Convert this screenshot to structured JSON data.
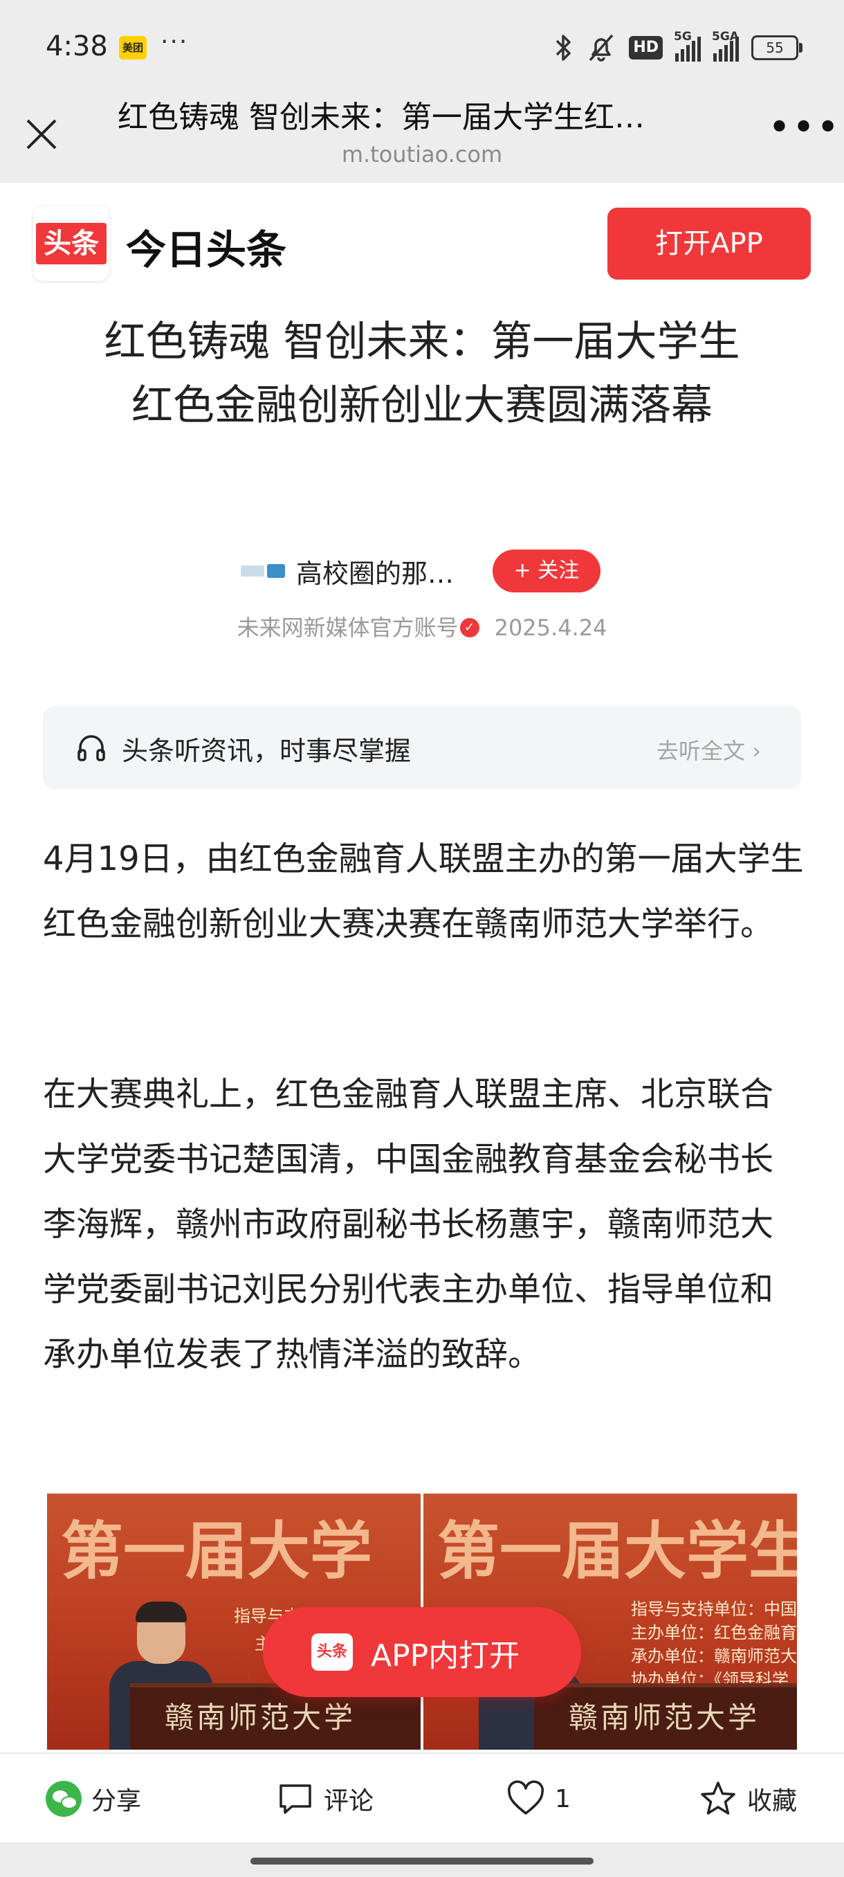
{
  "status_bar": {
    "time": "4:38",
    "meituan_badge": "美团",
    "overflow": "···",
    "hd": "HD",
    "sim1": "5G",
    "sim2": "5GA",
    "battery": "55"
  },
  "browser": {
    "title": "红色铸魂 智创未来：第一届大学生红…",
    "domain": "m.toutiao.com"
  },
  "brand": {
    "logo_text": "头条",
    "name": "今日头条",
    "open_app_label": "打开APP"
  },
  "article": {
    "headline": "红色铸魂 智创未来：第一届大学生红色金融创新创业大赛圆满落幕",
    "author_name": "高校圈的那…",
    "follow_label": "+ 关注",
    "account_type": "未来网新媒体官方账号",
    "date": "2025.4.24",
    "paragraphs": [
      "4月19日，由红色金融育人联盟主办的第一届大学生红色金融创新创业大赛决赛在赣南师范大学举行。",
      "在大赛典礼上，红色金融育人联盟主席、北京联合大学党委书记楚国清，中国金融教育基金会秘书长李海辉，赣州市政府副秘书长杨蕙宇，赣南师范大学党委副书记刘民分别代表主办单位、指导单位和承办单位发表了热情洋溢的致辞。"
    ]
  },
  "listen": {
    "label": "头条听资讯，时事尽掌握",
    "link": "去听全文"
  },
  "photo": {
    "banner_left": "第一届大学",
    "banner_right": "第一届大学生",
    "info_lines": [
      "指导与支持单位：中国",
      "主办单位：红色金融育",
      "承办单位：赣南师范大",
      "协办单位：《领导科学"
    ],
    "podium_text": "赣南师范大学"
  },
  "floating_button": {
    "logo_text": "头条",
    "label": "APP内打开"
  },
  "bottom_bar": {
    "share": "分享",
    "comment": "评论",
    "like_count": "1",
    "collect": "收藏"
  },
  "colors": {
    "accent": "#f0383a",
    "status_bg": "#ededed",
    "listen_bg": "#f4f5f6",
    "wechat_green": "#3cb64a"
  }
}
